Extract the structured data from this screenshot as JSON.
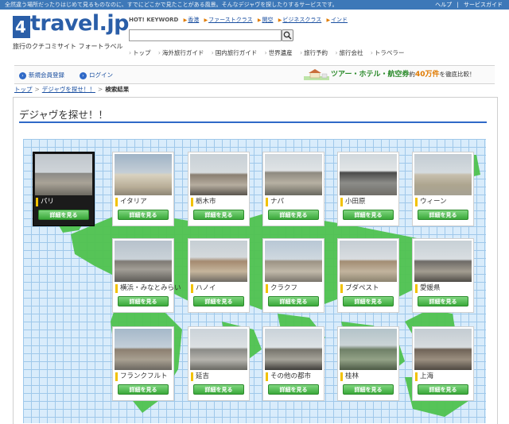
{
  "topbar": {
    "tagline": "全然違う場所だったりはじめて見るものなのに、すでにどこかで見たことがある風景。そんなデジャヴを探したりするサービスです。",
    "links": [
      "ヘルプ",
      "|",
      "サービスガイド"
    ]
  },
  "logo": {
    "word": "travel.jp",
    "mark": "4",
    "subtitle": "旅行のクチコミサイト フォートラベル"
  },
  "keywords": {
    "label": "HOT! KEYWORD",
    "items": [
      "香港",
      "ファーストクラス",
      "関空",
      "ビジネスクラス",
      "インド"
    ]
  },
  "search": {
    "placeholder": ""
  },
  "nav": [
    "トップ",
    "海外旅行ガイド",
    "国内旅行ガイド",
    "世界遺産",
    "旅行予約",
    "旅行会社",
    "トラベラー"
  ],
  "account": {
    "register": "新規会員登録",
    "login": "ログイン"
  },
  "banner": {
    "part1": "ツアー・ホテル・航空券",
    "part2": "約",
    "part3": "40万件",
    "part4": "を徹底比較！"
  },
  "breadcrumb": {
    "top": "トップ",
    "section": "デジャヴを探せ！！",
    "current": "検索結果"
  },
  "page": {
    "title": "デジャヴを探せ！！"
  },
  "button_label": "詳細を見る",
  "cards": [
    {
      "name": "パリ",
      "selected": true
    },
    {
      "name": "イタリア"
    },
    {
      "name": "栃木市"
    },
    {
      "name": "ナパ"
    },
    {
      "name": "小田原"
    },
    {
      "name": "ウィーン"
    },
    {
      "name": "横浜・みなとみらい"
    },
    {
      "name": "ハノイ"
    },
    {
      "name": "クラクフ"
    },
    {
      "name": "ブダペスト"
    },
    {
      "name": "愛媛県"
    },
    {
      "name": "フランクフルト"
    },
    {
      "name": "延吉"
    },
    {
      "name": "その他の都市"
    },
    {
      "name": "桂林"
    },
    {
      "name": "上海"
    }
  ],
  "colors": {
    "brand": "#2a5ea8",
    "topbar": "#3d78b8",
    "accent_line": "#2f69c7",
    "button": "#3aa93a",
    "map_sea": "#d9ecfb",
    "land": "#4fc24f"
  }
}
